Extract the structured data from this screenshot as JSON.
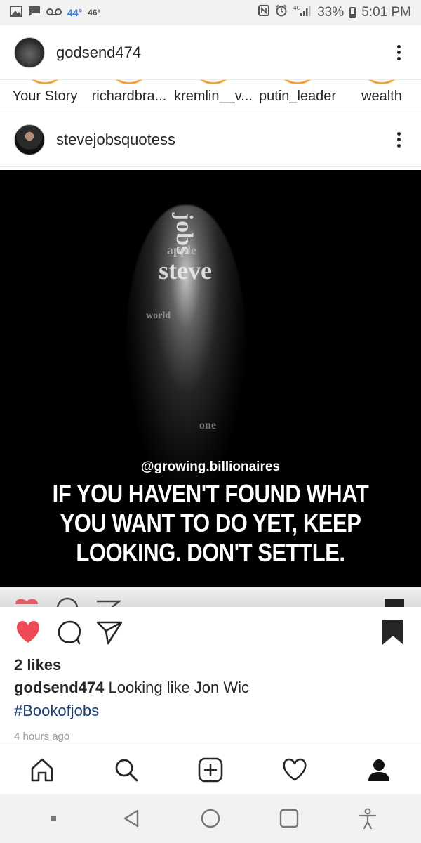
{
  "status_bar": {
    "temp_1": "44°",
    "temp_2": "46°",
    "battery": "33%",
    "time": "5:01 PM",
    "network": "4G",
    "icons": [
      "image-icon",
      "message-icon",
      "voicemail-icon",
      "nfc-icon",
      "alarm-icon",
      "signal-icon",
      "battery-icon"
    ]
  },
  "account": {
    "username": "godsend474"
  },
  "stories": [
    {
      "label": "Your Story"
    },
    {
      "label": "richardbra..."
    },
    {
      "label": "kremlin__v..."
    },
    {
      "label": "putin_leader"
    },
    {
      "label": "wealth"
    }
  ],
  "post": {
    "author": "stevejobsquotess",
    "image_handle": "@growing.billionaires",
    "quote_lines": [
      "IF YOU HAVEN'T FOUND WHAT",
      "YOU WANT TO DO YET, KEEP",
      "LOOKING. DON'T SETTLE."
    ],
    "face_words": [
      "jobs",
      "apple",
      "steve",
      "world",
      "one"
    ],
    "likes": "2 likes",
    "caption_user": "godsend474",
    "caption_text": "Looking like Jon Wic",
    "hashtag": "#Bookofjobs",
    "time_ago": "4 hours ago"
  },
  "colors": {
    "like_red": "#ed4956",
    "hashtag_blue": "#1b3d72",
    "story_ring": "#f2a03a"
  },
  "bottom_nav": [
    "home-icon",
    "search-icon",
    "add-post-icon",
    "activity-heart-icon",
    "profile-icon"
  ],
  "android_nav": [
    "recents-dot-icon",
    "back-icon",
    "home-circle-icon",
    "overview-square-icon",
    "accessibility-icon"
  ]
}
